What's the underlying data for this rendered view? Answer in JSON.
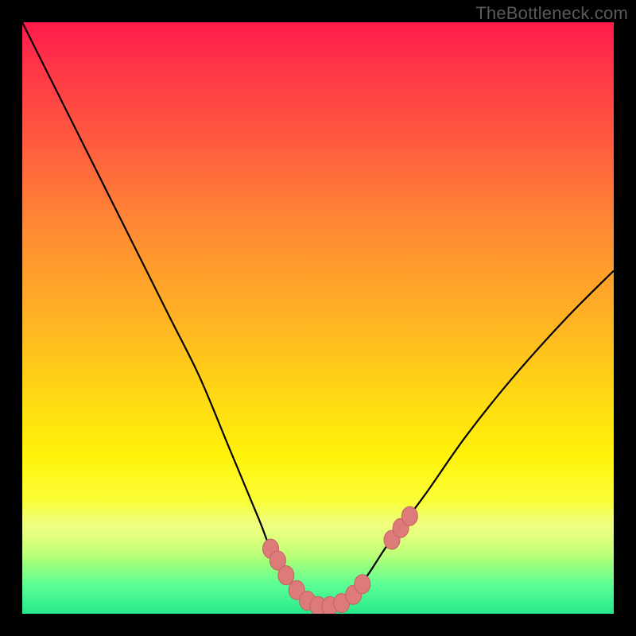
{
  "watermark": "TheBottleneck.com",
  "colors": {
    "frame": "#000000",
    "curve": "#000000",
    "marker_fill": "#dd7b7b",
    "marker_stroke": "#c76060",
    "gradient_stops": [
      "#ff1a4a",
      "#ff5a3f",
      "#ffb224",
      "#fff20a",
      "#5eff94",
      "#26e88d"
    ]
  },
  "chart_data": {
    "type": "line",
    "title": "",
    "xlabel": "",
    "ylabel": "",
    "xlim": [
      0,
      100
    ],
    "ylim": [
      0,
      100
    ],
    "grid": false,
    "series": [
      {
        "name": "bottleneck-curve",
        "x": [
          0,
          5,
          10,
          15,
          20,
          25,
          30,
          35,
          40,
          42,
          45,
          47,
          49,
          51,
          53,
          55,
          58,
          62,
          68,
          75,
          83,
          92,
          100
        ],
        "y": [
          100,
          90,
          80,
          70,
          60,
          50,
          40,
          28,
          16,
          11,
          6,
          3,
          1.5,
          1.2,
          1.5,
          3,
          6,
          12,
          20,
          30,
          40,
          50,
          58
        ]
      }
    ],
    "markers": [
      {
        "name": "left-cluster",
        "x": 42.0,
        "y": 11.0
      },
      {
        "name": "left-cluster",
        "x": 43.2,
        "y": 9.0
      },
      {
        "name": "left-cluster",
        "x": 44.6,
        "y": 6.5
      },
      {
        "name": "left-cluster",
        "x": 46.4,
        "y": 4.0
      },
      {
        "name": "left-cluster",
        "x": 48.2,
        "y": 2.2
      },
      {
        "name": "bottom",
        "x": 50.0,
        "y": 1.3
      },
      {
        "name": "bottom",
        "x": 52.0,
        "y": 1.3
      },
      {
        "name": "bottom",
        "x": 54.0,
        "y": 1.8
      },
      {
        "name": "right-near",
        "x": 56.0,
        "y": 3.2
      },
      {
        "name": "right-near",
        "x": 57.5,
        "y": 5.0
      },
      {
        "name": "right-cluster",
        "x": 62.5,
        "y": 12.5
      },
      {
        "name": "right-cluster",
        "x": 64.0,
        "y": 14.5
      },
      {
        "name": "right-cluster",
        "x": 65.5,
        "y": 16.5
      }
    ]
  }
}
